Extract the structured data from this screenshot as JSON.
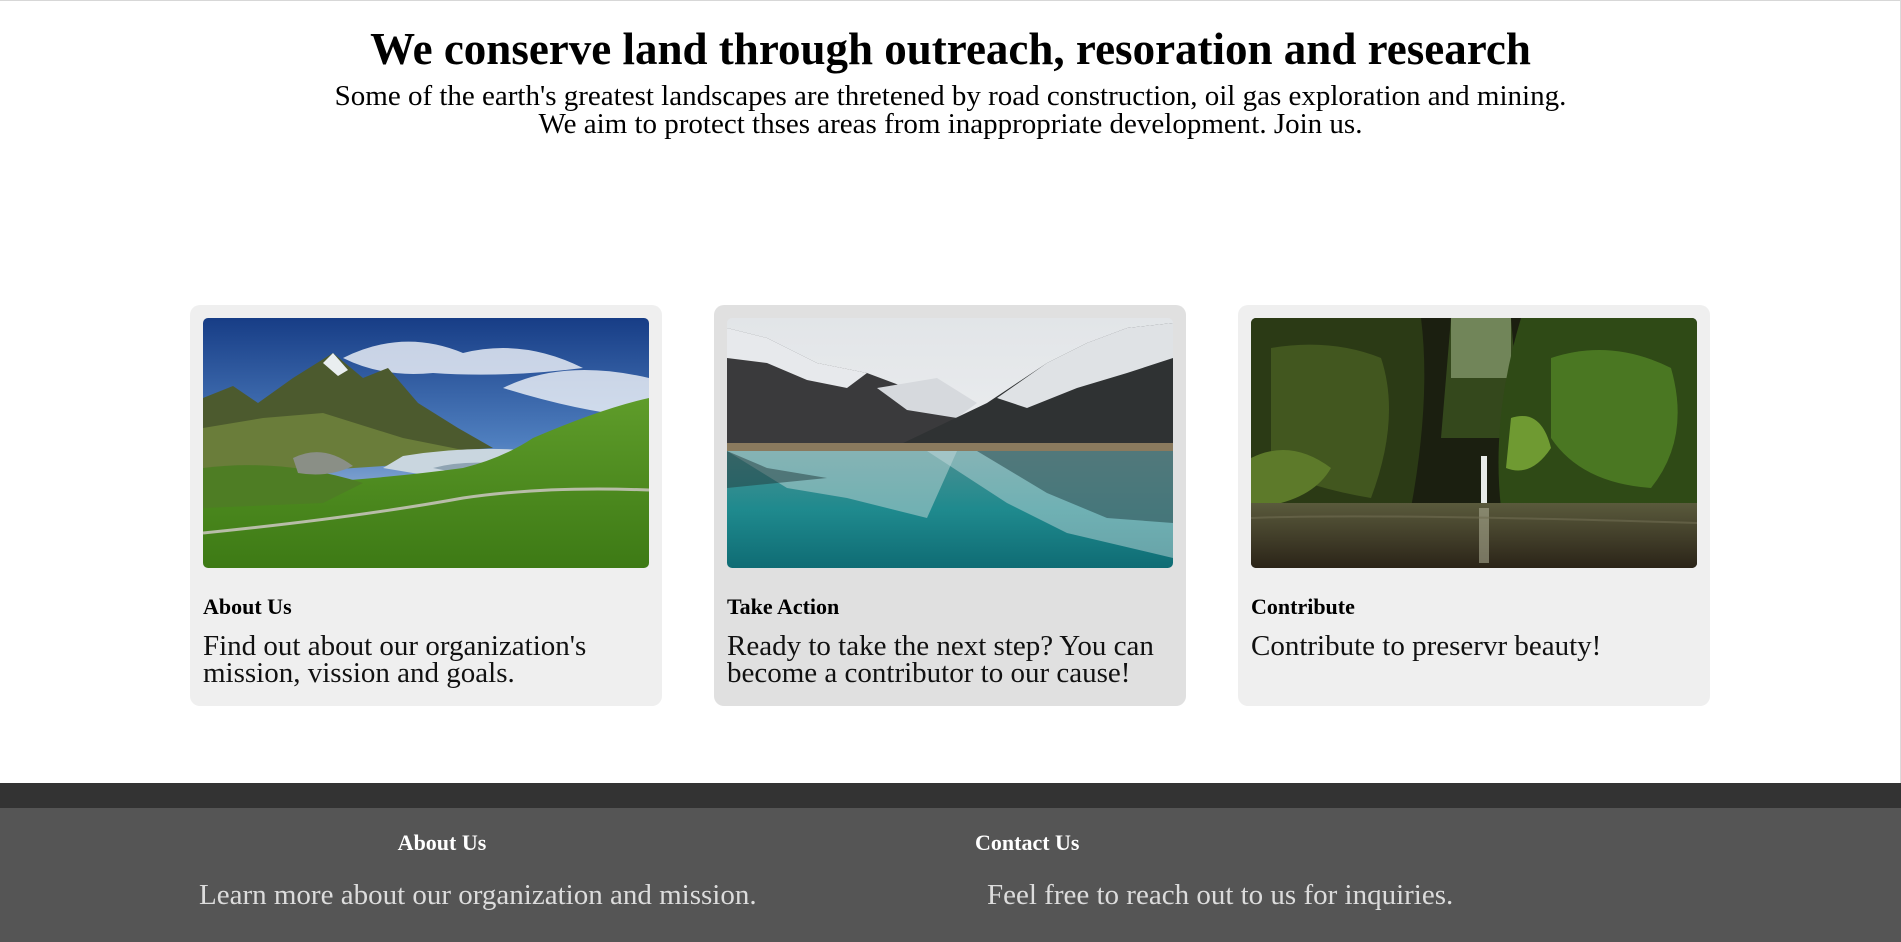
{
  "hero": {
    "title": "We conserve land through outreach, resoration and research",
    "line1": "Some of the earth's greatest landscapes are thretened by road construction, oil gas exploration and mining.",
    "line2": "We aim to protect thses areas from inappropriate development. Join us."
  },
  "cards": [
    {
      "image": "mountain-valley-landscape",
      "title": "About Us",
      "text": "Find out about our organization's mission, vission and goals."
    },
    {
      "image": "snowy-mountains-lake-reflection",
      "title": "Take Action",
      "text": "Ready to take the next step? You can become a contributor to our cause!"
    },
    {
      "image": "forest-waterfall-gorge",
      "title": "Contribute",
      "text": "Contribute to preservr beauty!"
    }
  ],
  "footer": {
    "about": {
      "title": "About Us",
      "text": "Learn more about our organization and mission."
    },
    "contact": {
      "title": "Contact Us",
      "text": "Feel free to reach out to us for inquiries."
    }
  },
  "colors": {
    "card_bg": "#efefef",
    "card_hover_bg": "#e0e0e0",
    "footer_bg": "#555555",
    "footer_bar": "#333333"
  }
}
